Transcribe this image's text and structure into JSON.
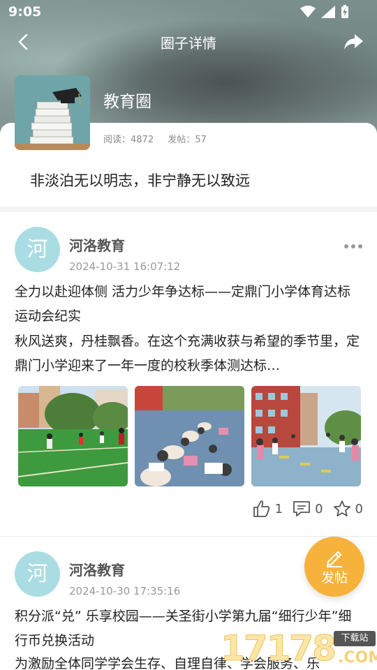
{
  "status_bar": {
    "time": "9:05"
  },
  "nav": {
    "title": "圈子详情"
  },
  "circle": {
    "name": "教育圈",
    "read_label": "阅读：4872",
    "post_label": "发帖：57",
    "motto": "非淡泊无以明志，非宁静无以致远"
  },
  "posts": [
    {
      "avatar_char": "河",
      "author": "河洛教育",
      "time": "2024-10-31 16:07:12",
      "title": "全力以赴迎体侧 活力少年争达标——定鼎门小学体育达标运动会纪实",
      "body": "秋风送爽，丹桂飘香。在这个充满收获与希望的季节里，定鼎门小学迎来了一年一度的校秋季体测达标…",
      "likes": "1",
      "comments": "0",
      "favorites": "0"
    },
    {
      "avatar_char": "河",
      "author": "河洛教育",
      "time": "2024-10-30 17:35:16",
      "title": "积分派“兑” 乐享校园——关圣街小学第九届“细行少年”细行币兑换活动",
      "body": "为激励全体同学学会生存、自理自律、学会服务、乐"
    }
  ],
  "fab": {
    "label": "发帖"
  },
  "watermark": {
    "number": "17178",
    "tag": "下载站",
    "suffix": ".COM"
  },
  "colors": {
    "accent": "#f7b23b",
    "avatar": "#a9dde3"
  }
}
